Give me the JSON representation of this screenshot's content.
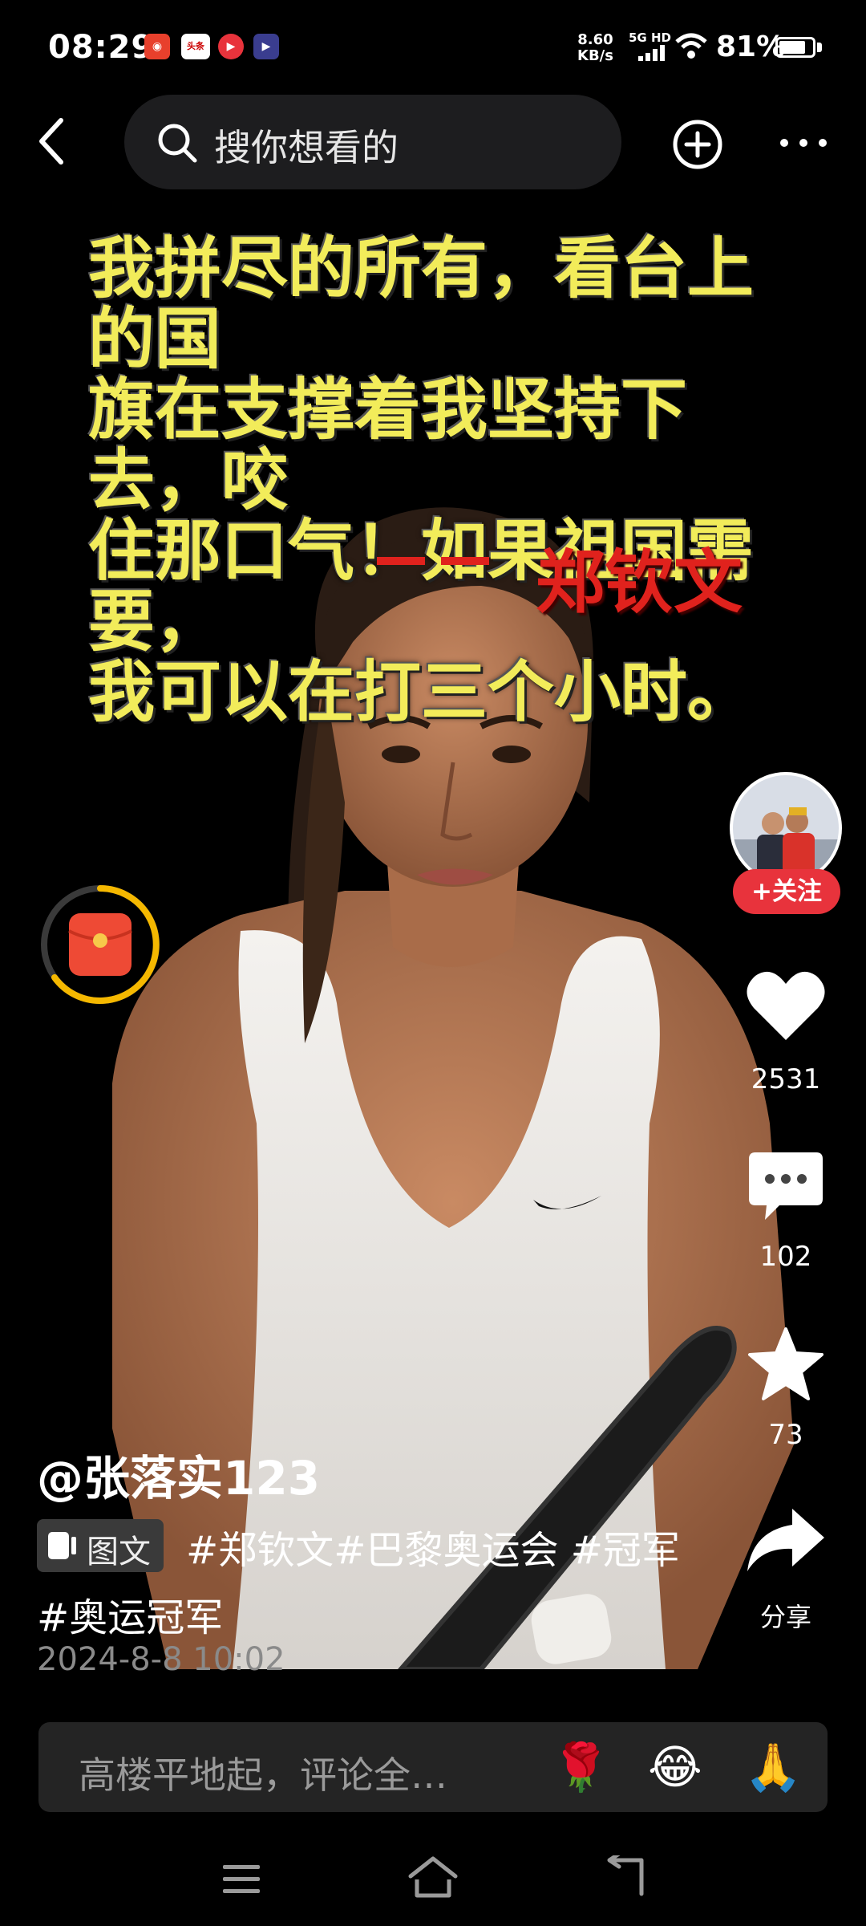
{
  "status_bar": {
    "time": "08:29",
    "net_speed": "8.60",
    "net_unit": "KB/s",
    "signal": "5G HD",
    "battery_percent": "81%",
    "battery_level": 0.81,
    "app_icons": [
      "weibo-icon",
      "toutiao-icon",
      "video-icon",
      "player-icon"
    ],
    "app_icon_labels": [
      "",
      "头条",
      "",
      ""
    ]
  },
  "top_bar": {
    "search_placeholder": "搜你想看的"
  },
  "post": {
    "quote_lines": [
      "我拼尽的所有，看台上的国",
      "旗在支撑着我坚持下去，咬",
      "住那口气！如果祖国需要，",
      "我可以在打三个小时。"
    ],
    "quote_author": "郑钦文",
    "author_handle": "@张落实123",
    "type_tag": "图文",
    "description": "#郑钦文#巴黎奥运会 #冠军 #奥运冠军",
    "date": "2024-8-8 10:02"
  },
  "rail": {
    "follow_label": "+关注",
    "likes": "2531",
    "comments": "102",
    "favorites": "73",
    "share_label": "分享"
  },
  "comment_bar": {
    "placeholder": "高楼平地起，评论全…",
    "emojis": [
      "🌹",
      "😂",
      "🙏"
    ]
  },
  "colors": {
    "quote_text": "#f2ec5a",
    "quote_author": "#e0221d",
    "follow_button": "#e8333c",
    "red_packet_ring": "#f5b800"
  }
}
